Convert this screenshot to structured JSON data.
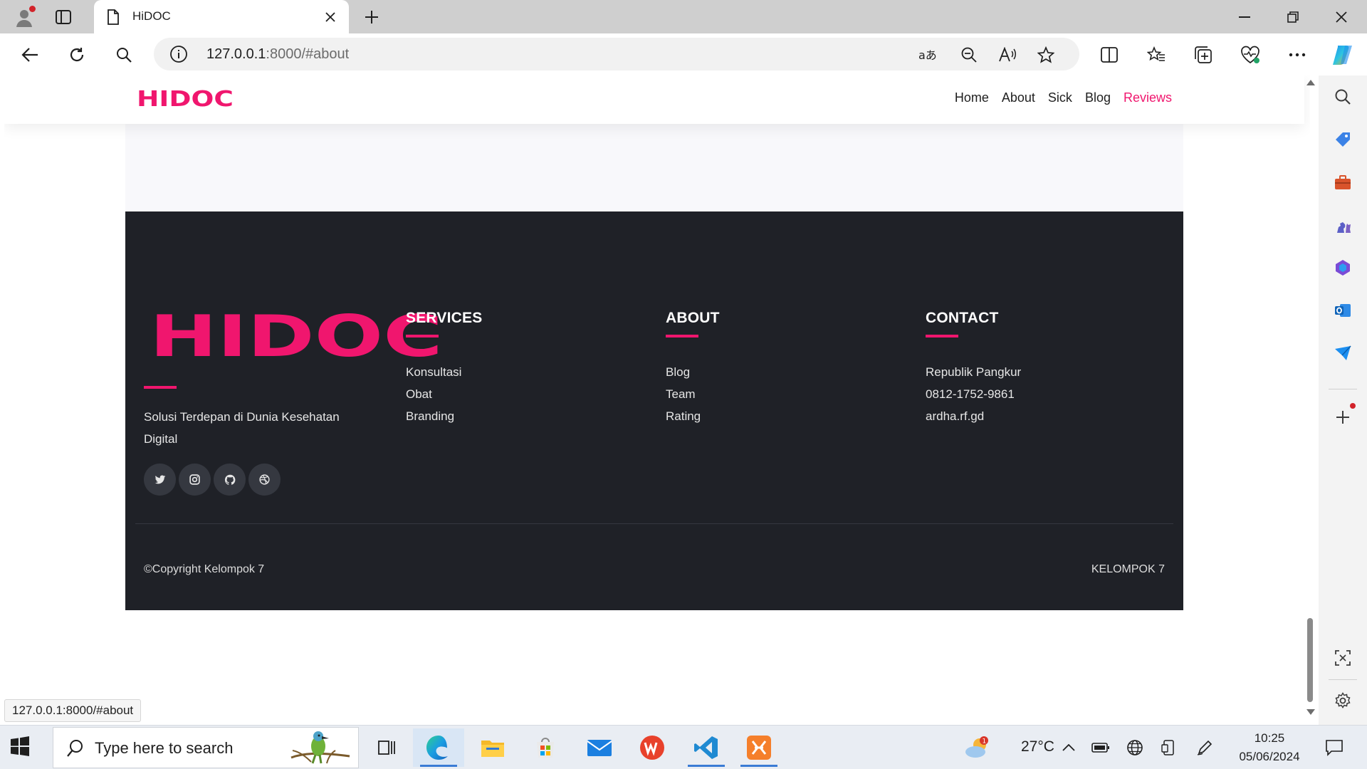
{
  "browser": {
    "tab_title": "HiDOC",
    "url_host": "127.0.0.1",
    "url_rest": ":8000/#about",
    "status_url": "127.0.0.1:8000/#about"
  },
  "site": {
    "logo": "HIDOC",
    "nav": [
      "Home",
      "About",
      "Sick",
      "Blog",
      "Reviews"
    ],
    "active_nav": "Reviews",
    "accent_color": "#f0166e"
  },
  "footer": {
    "logo": "HIDOC",
    "tagline_line1": "Solusi Terdepan di Dunia Kesehatan",
    "tagline_line2": "Digital",
    "socials": [
      "twitter-icon",
      "instagram-icon",
      "github-icon",
      "dribbble-icon"
    ],
    "columns": [
      {
        "title": "SERVICES",
        "items": [
          "Konsultasi",
          "Obat",
          "Branding"
        ]
      },
      {
        "title": "ABOUT",
        "items": [
          "Blog",
          "Team",
          "Rating"
        ]
      },
      {
        "title": "CONTACT",
        "items": [
          "Republik Pangkur",
          "0812-1752-9861",
          "ardha.rf.gd"
        ]
      }
    ],
    "copyright": "©Copyright Kelompok 7",
    "brand": "KELOMPOK 7"
  },
  "taskbar": {
    "search_placeholder": "Type here to search",
    "temperature": "27°C",
    "weather_badge": "1",
    "time": "10:25",
    "date": "05/06/2024"
  }
}
